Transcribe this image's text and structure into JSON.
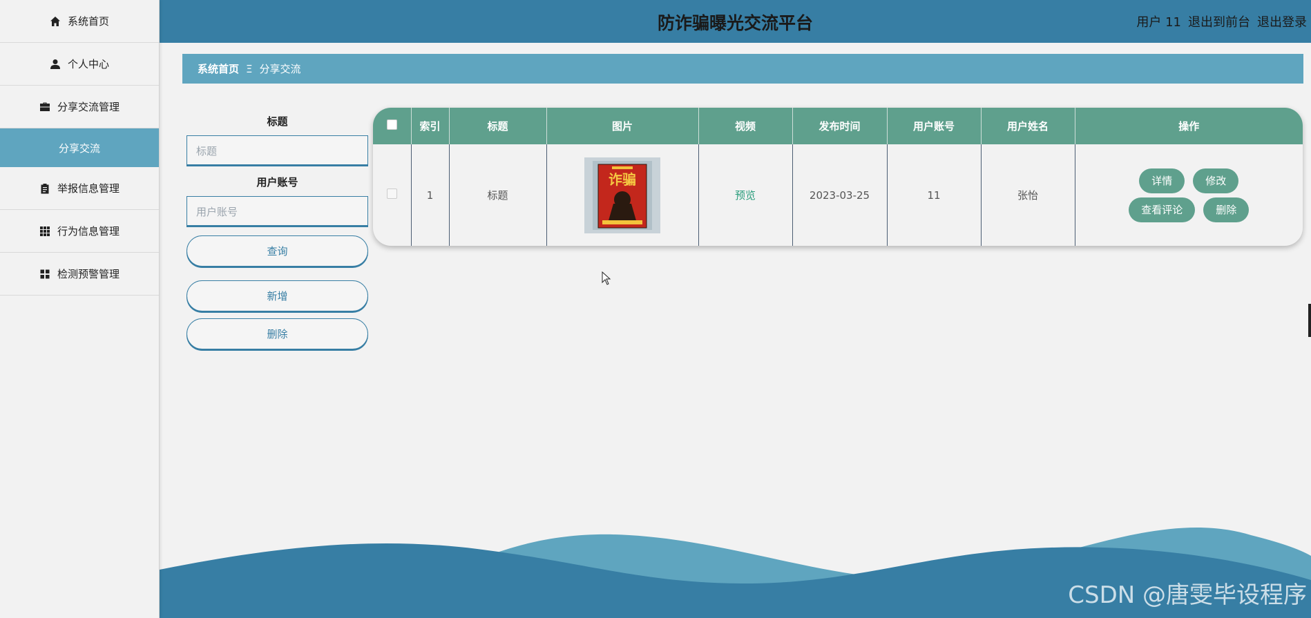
{
  "sidebar": {
    "items": [
      {
        "label": "系统首页",
        "icon": "home-icon"
      },
      {
        "label": "个人中心",
        "icon": "user-icon"
      },
      {
        "label": "分享交流管理",
        "icon": "briefcase-icon"
      },
      {
        "label": "分享交流",
        "icon": ""
      },
      {
        "label": "举报信息管理",
        "icon": "clipboard-icon"
      },
      {
        "label": "行为信息管理",
        "icon": "grid-icon"
      },
      {
        "label": "检测预警管理",
        "icon": "apps-icon"
      }
    ]
  },
  "header": {
    "title": "防诈骗曝光交流平台",
    "user": "用户 11",
    "back_front": "退出到前台",
    "logout": "退出登录",
    "background": "#377ea4"
  },
  "breadcrumb": {
    "home": "系统首页",
    "separator": "Ξ",
    "current": "分享交流"
  },
  "search": {
    "title_label": "标题",
    "title_placeholder": "标题",
    "account_label": "用户账号",
    "account_placeholder": "用户账号",
    "query_button": "查询",
    "add_button": "新增",
    "delete_button": "删除"
  },
  "table": {
    "headers": [
      "索引",
      "标题",
      "图片",
      "视频",
      "发布时间",
      "用户账号",
      "用户姓名",
      "操作"
    ],
    "rows": [
      {
        "index": "1",
        "title": "标题",
        "video": "预览",
        "date": "2023-03-25",
        "account": "11",
        "name": "张怡",
        "poster_text": "诈骗"
      }
    ],
    "actions": {
      "detail": "详情",
      "edit": "修改",
      "comments": "查看评论",
      "delete": "删除"
    },
    "header_color": "#5fa08d"
  },
  "watermark": "CSDN @唐雯毕设程序"
}
